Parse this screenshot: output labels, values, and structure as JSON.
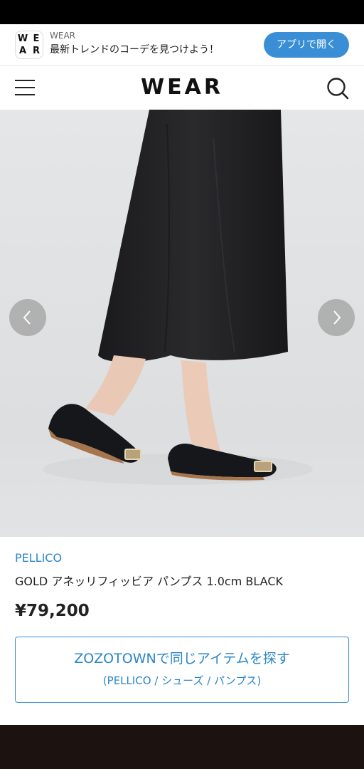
{
  "app_banner": {
    "logo_letters": [
      "W",
      "E",
      "A",
      "R"
    ],
    "app_name": "WEAR",
    "tagline": "最新トレンドのコーデを見つけよう！",
    "open_button": "アプリで開く",
    "accent_color": "#3a8ed6"
  },
  "header": {
    "logo": "WEAR",
    "menu_icon": "hamburger-menu-icon",
    "search_icon": "search-icon"
  },
  "gallery": {
    "prev_icon": "chevron-left-icon",
    "next_icon": "chevron-right-icon"
  },
  "product": {
    "brand": "PELLICO",
    "name": "GOLD アネッリフィッビア パンプス 1.0cm BLACK",
    "price": "¥79,200"
  },
  "zozo_button": {
    "title": "ZOZOTOWNで同じアイテムを探す",
    "subtitle": "(PELLICO / シューズ / パンプス)"
  },
  "colors": {
    "link": "#2b86c8",
    "text": "#222222"
  }
}
